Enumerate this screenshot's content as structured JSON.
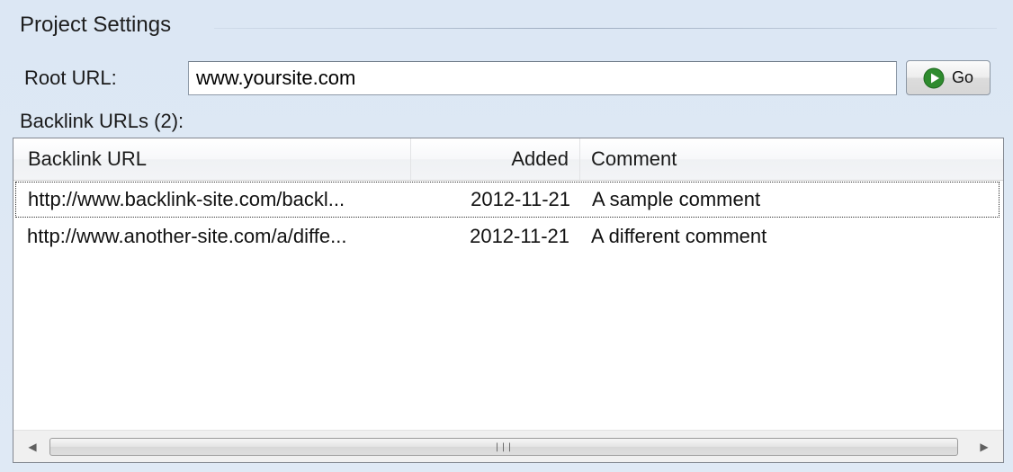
{
  "group": {
    "title": "Project Settings"
  },
  "root_url": {
    "label": "Root URL:",
    "value": "www.yoursite.com",
    "go_label": "Go"
  },
  "backlinks": {
    "label": "Backlink URLs (2):",
    "columns": [
      "Backlink URL",
      "Added",
      "Comment"
    ],
    "rows": [
      {
        "url": "http://www.backlink-site.com/backl...",
        "added": "2012-11-21",
        "comment": "A sample comment"
      },
      {
        "url": "http://www.another-site.com/a/diffe...",
        "added": "2012-11-21",
        "comment": "A different comment"
      }
    ]
  },
  "colors": {
    "panel_bg": "#dfe9f5",
    "go_icon": "#2e8b2e"
  }
}
